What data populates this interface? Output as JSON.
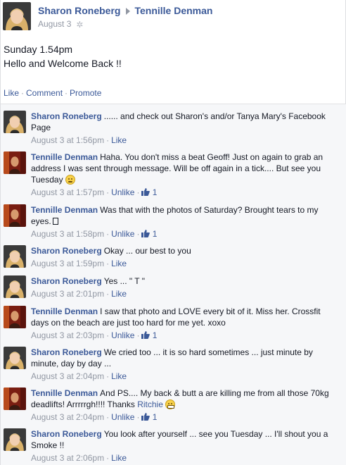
{
  "post": {
    "author": "Sharon Roneberg",
    "target": "Tennille Denman",
    "date": "August 3",
    "body_line1": "Sunday 1.54pm",
    "body_line2": "Hello and Welcome Back !!",
    "actions": {
      "like": "Like",
      "comment": "Comment",
      "promote": "Promote"
    }
  },
  "comments": [
    {
      "author": "Sharon Roneberg",
      "text": "...... and check out Sharon's and/or Tanya Mary's Facebook Page",
      "time": "August 3 at 1:56pm",
      "action": "Like"
    },
    {
      "author": "Tennille Denman",
      "text": "Haha. You don't miss a beat Geoff! Just on again to grab an address I was sent through message. Will be off again in a tick.... But see you Tuesday",
      "time": "August 3 at 1:57pm",
      "action": "Unlike",
      "likes": "1"
    },
    {
      "author": "Tennille Denman",
      "text": "Was that with the photos of Saturday? Brought tears to my eyes.",
      "time": "August 3 at 1:58pm",
      "action": "Unlike",
      "likes": "1"
    },
    {
      "author": "Sharon Roneberg",
      "text": "Okay ... our best to you",
      "time": "August 3 at 1:59pm",
      "action": "Like"
    },
    {
      "author": "Sharon Roneberg",
      "text": "Yes ... \" T \"",
      "time": "August 3 at 2:01pm",
      "action": "Like"
    },
    {
      "author": "Tennille Denman",
      "text": "I saw that photo and LOVE every bit of it. Miss her. Crossfit days on the beach are just too hard for me yet. xoxo",
      "time": "August 3 at 2:03pm",
      "action": "Unlike",
      "likes": "1"
    },
    {
      "author": "Sharon Roneberg",
      "text": "We cried too ... it is so hard sometimes ... just minute by minute, day by day ...",
      "time": "August 3 at 2:04pm",
      "action": "Like"
    },
    {
      "author": "Tennille Denman",
      "text": "And PS.... My back & butt a are killing me from all those 70kg deadlifts! Arrrrrgh!!!! Thanks",
      "mention": "Ritchie",
      "time": "August 3 at 2:04pm",
      "action": "Unlike",
      "likes": "1"
    },
    {
      "author": "Sharon Roneberg",
      "text": "You look after yourself ... see you Tuesday ... I'll shout you a Smoke !!",
      "time": "August 3 at 2:06pm",
      "action": "Like"
    }
  ],
  "icons": {
    "gear": "gear-icon",
    "thumb": "thumbs-up-icon",
    "arrow": "arrow-right-icon"
  },
  "colors": {
    "link": "#3b5998",
    "meta": "#9197a3",
    "comment_bg": "#f6f7f9"
  }
}
